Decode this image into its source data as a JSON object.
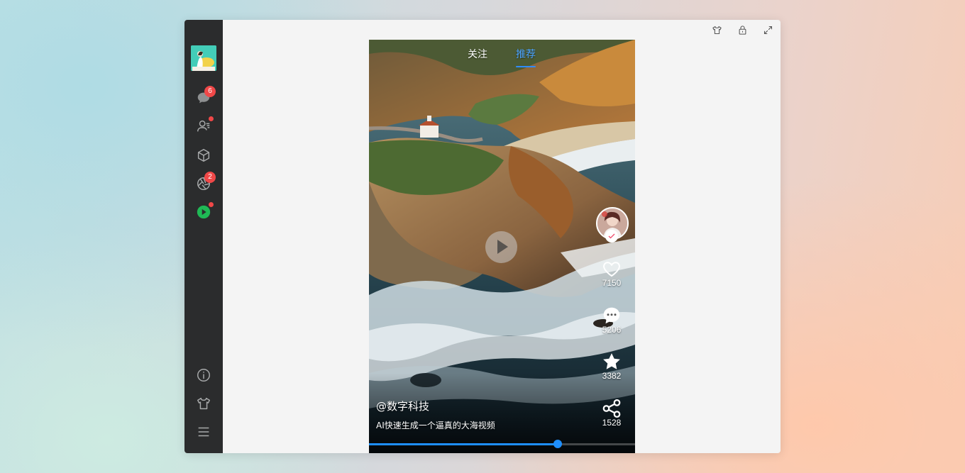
{
  "topbar": {
    "icons": [
      "skin-icon",
      "lock-icon",
      "fullscreen-icon"
    ]
  },
  "sidebar": {
    "items": [
      {
        "name": "chat",
        "icon": "chat-bubble-icon",
        "badge": "6"
      },
      {
        "name": "contacts",
        "icon": "contacts-icon",
        "dot": true
      },
      {
        "name": "apps",
        "icon": "cube-icon"
      },
      {
        "name": "moments",
        "icon": "aperture-icon",
        "badge": "2"
      },
      {
        "name": "video",
        "icon": "play-circle-icon",
        "dot": true
      }
    ],
    "bottom_items": [
      "info-icon",
      "skin-icon",
      "menu-icon"
    ]
  },
  "video": {
    "tabs": [
      {
        "label": "关注",
        "active": false
      },
      {
        "label": "推荐",
        "active": true
      }
    ],
    "author": "@数字科技",
    "description": "AI快速生成一个逼真的大海视频",
    "actions": {
      "like": {
        "icon": "heart-icon",
        "count": "7150"
      },
      "comment": {
        "icon": "comment-icon",
        "count": "5206"
      },
      "favorite": {
        "icon": "star-icon",
        "count": "3382"
      },
      "share": {
        "icon": "share-icon",
        "count": "1528"
      }
    },
    "progress": 0.71
  },
  "colors": {
    "accent": "#1e8fff",
    "badge": "#f04848",
    "sidebar_bg": "#2b2c2d",
    "play_icon": "#1fb955"
  }
}
